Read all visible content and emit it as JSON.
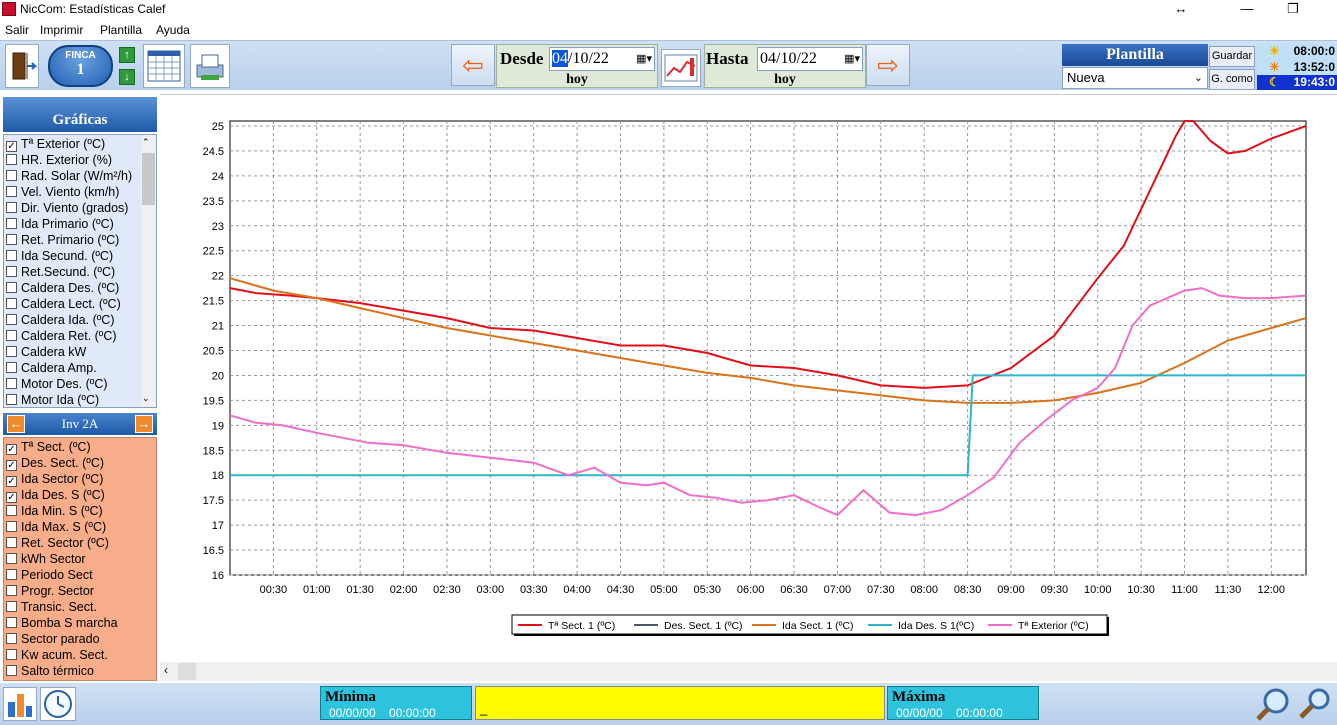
{
  "window": {
    "title": "NicCom: Estadísticas Calef",
    "restore_glyph": "↔",
    "minimize_glyph": "—",
    "maximize_glyph": "❐"
  },
  "menu": [
    "Salir",
    "Imprimir",
    "Plantilla",
    "Ayuda"
  ],
  "toolbar": {
    "finca_label": "FINCA",
    "finca_value": "1",
    "desde_label": "Desde",
    "desde_date_sel": "04",
    "desde_date_rest": "/10/22",
    "desde_hoy": "hoy",
    "hasta_label": "Hasta",
    "hasta_date": "04/10/22",
    "hasta_hoy": "hoy",
    "plantilla_title": "Plantilla",
    "plantilla_value": "Nueva",
    "guardar_label": "Guardar",
    "guardar_como_label": "G. como",
    "time_sunrise": "08:00:0",
    "time_now": "13:52:0",
    "time_sunset": "19:43:0"
  },
  "sidebar": {
    "graficas_title": "Gráficas",
    "list1": [
      {
        "label": "Tª Exterior (ºC)",
        "checked": true
      },
      {
        "label": "HR. Exterior (%)",
        "checked": false
      },
      {
        "label": "Rad. Solar (W/m²/h)",
        "checked": false
      },
      {
        "label": "Vel. Viento (km/h)",
        "checked": false
      },
      {
        "label": "Dir. Viento (grados)",
        "checked": false
      },
      {
        "label": "Ida Primario (ºC)",
        "checked": false
      },
      {
        "label": "Ret. Primario (ºC)",
        "checked": false
      },
      {
        "label": "Ida Secund. (ºC)",
        "checked": false
      },
      {
        "label": "Ret.Secund. (ºC)",
        "checked": false
      },
      {
        "label": "Caldera Des. (ºC)",
        "checked": false
      },
      {
        "label": "Caldera Lect. (ºC)",
        "checked": false
      },
      {
        "label": "Caldera Ida. (ºC)",
        "checked": false
      },
      {
        "label": "Caldera Ret. (ºC)",
        "checked": false
      },
      {
        "label": "Caldera kW",
        "checked": false
      },
      {
        "label": "Caldera Amp.",
        "checked": false
      },
      {
        "label": "Motor Des. (ºC)",
        "checked": false
      },
      {
        "label": "Motor Ida (ºC)",
        "checked": false
      }
    ],
    "inv_title": "Inv 2A",
    "list2": [
      {
        "label": "Tª  Sect. (ºC)",
        "checked": true
      },
      {
        "label": "Des.  Sect. (ºC)",
        "checked": true
      },
      {
        "label": "Ida Sector (ºC)",
        "checked": true
      },
      {
        "label": "Ida Des. S (ºC)",
        "checked": true
      },
      {
        "label": "Ida Min. S (ºC)",
        "checked": false
      },
      {
        "label": "Ida Max. S (ºC)",
        "checked": false
      },
      {
        "label": "Ret. Sector (ºC)",
        "checked": false
      },
      {
        "label": "kWh Sector",
        "checked": false
      },
      {
        "label": "Periodo Sect",
        "checked": false
      },
      {
        "label": "Progr. Sector",
        "checked": false
      },
      {
        "label": "Transic. Sect.",
        "checked": false
      },
      {
        "label": "Bomba S marcha",
        "checked": false
      },
      {
        "label": "Sector parado",
        "checked": false
      },
      {
        "label": "Kw acum. Sect.",
        "checked": false
      },
      {
        "label": "Salto térmico",
        "checked": false
      }
    ]
  },
  "bottom": {
    "minima_label": "Mínima",
    "minima_value": "00/00/00    00:00:00",
    "maxima_label": "Máxima",
    "maxima_value": "00/00/00    00:00:00",
    "message": "_"
  },
  "chart_data": {
    "type": "line",
    "x_ticks": [
      "00:30",
      "01:00",
      "01:30",
      "02:00",
      "02:30",
      "03:00",
      "03:30",
      "04:00",
      "04:30",
      "05:00",
      "05:30",
      "06:00",
      "06:30",
      "07:00",
      "07:30",
      "08:00",
      "08:30",
      "09:00",
      "09:30",
      "10:00",
      "10:30",
      "11:00",
      "11:30",
      "12:00"
    ],
    "y_ticks": [
      "16",
      "16.5",
      "17",
      "17.5",
      "18",
      "18.5",
      "19",
      "19.5",
      "20",
      "20.5",
      "21",
      "21.5",
      "22",
      "22.5",
      "23",
      "23.5",
      "24",
      "24.5",
      "25"
    ],
    "ylim": [
      16,
      25.1
    ],
    "xlim_hours": [
      0,
      12.4
    ],
    "grid": true,
    "legend_position": "bottom",
    "series": [
      {
        "name": "Tª Sect. 1 (ºC)",
        "color": "#e0101a",
        "x": [
          0,
          0.3,
          0.7,
          1.0,
          1.5,
          2.0,
          2.5,
          3.0,
          3.5,
          4.0,
          4.5,
          5.0,
          5.5,
          6.0,
          6.5,
          7.0,
          7.5,
          8.0,
          8.5,
          9.0,
          9.5,
          10.0,
          10.3,
          10.6,
          10.9,
          11.0,
          11.1,
          11.3,
          11.5,
          11.7,
          12.0,
          12.4
        ],
        "y": [
          21.75,
          21.65,
          21.6,
          21.55,
          21.45,
          21.3,
          21.15,
          20.95,
          20.9,
          20.75,
          20.6,
          20.6,
          20.45,
          20.2,
          20.15,
          20.0,
          19.8,
          19.75,
          19.8,
          20.15,
          20.8,
          21.95,
          22.6,
          23.7,
          24.8,
          25.1,
          25.1,
          24.7,
          24.45,
          24.5,
          24.75,
          25.0
        ]
      },
      {
        "name": "Des. Sect. 1 (ºC)",
        "color": "#4a5a6a",
        "x": [],
        "y": []
      },
      {
        "name": "Ida Sect.  1 (ºC)",
        "color": "#d9731e",
        "x": [
          0,
          0.5,
          1.0,
          1.5,
          2.0,
          2.5,
          3.0,
          3.5,
          4.0,
          4.5,
          5.0,
          5.5,
          6.0,
          6.5,
          7.0,
          7.5,
          8.0,
          8.5,
          9.0,
          9.5,
          10.0,
          10.5,
          11.0,
          11.5,
          12.0,
          12.4
        ],
        "y": [
          21.95,
          21.7,
          21.55,
          21.35,
          21.15,
          20.95,
          20.8,
          20.65,
          20.5,
          20.35,
          20.2,
          20.05,
          19.95,
          19.8,
          19.7,
          19.6,
          19.5,
          19.45,
          19.45,
          19.5,
          19.65,
          19.85,
          20.25,
          20.7,
          20.95,
          21.15
        ]
      },
      {
        "name": "Ida Des. S 1(ºC)",
        "color": "#2fb5c6",
        "x": [
          0,
          8.5,
          8.56,
          12.4
        ],
        "y": [
          18.0,
          18.0,
          20.0,
          20.0
        ]
      },
      {
        "name": "Tª Exterior (ºC)",
        "color": "#ee6fc8",
        "x": [
          0,
          0.3,
          0.6,
          1.0,
          1.3,
          1.6,
          2.0,
          2.5,
          3.0,
          3.5,
          3.9,
          4.2,
          4.5,
          4.8,
          5.0,
          5.3,
          5.6,
          5.9,
          6.2,
          6.5,
          6.8,
          7.0,
          7.3,
          7.6,
          7.9,
          8.2,
          8.5,
          8.8,
          9.1,
          9.4,
          9.7,
          10.0,
          10.2,
          10.4,
          10.6,
          10.8,
          11.0,
          11.2,
          11.4,
          11.7,
          12.0,
          12.4
        ],
        "y": [
          19.2,
          19.05,
          19.0,
          18.85,
          18.75,
          18.65,
          18.6,
          18.45,
          18.35,
          18.25,
          18.0,
          18.15,
          17.85,
          17.8,
          17.85,
          17.6,
          17.55,
          17.45,
          17.5,
          17.6,
          17.35,
          17.2,
          17.7,
          17.25,
          17.2,
          17.3,
          17.6,
          17.95,
          18.65,
          19.1,
          19.5,
          19.75,
          20.15,
          21.0,
          21.4,
          21.55,
          21.7,
          21.75,
          21.6,
          21.55,
          21.55,
          21.6
        ]
      }
    ]
  }
}
